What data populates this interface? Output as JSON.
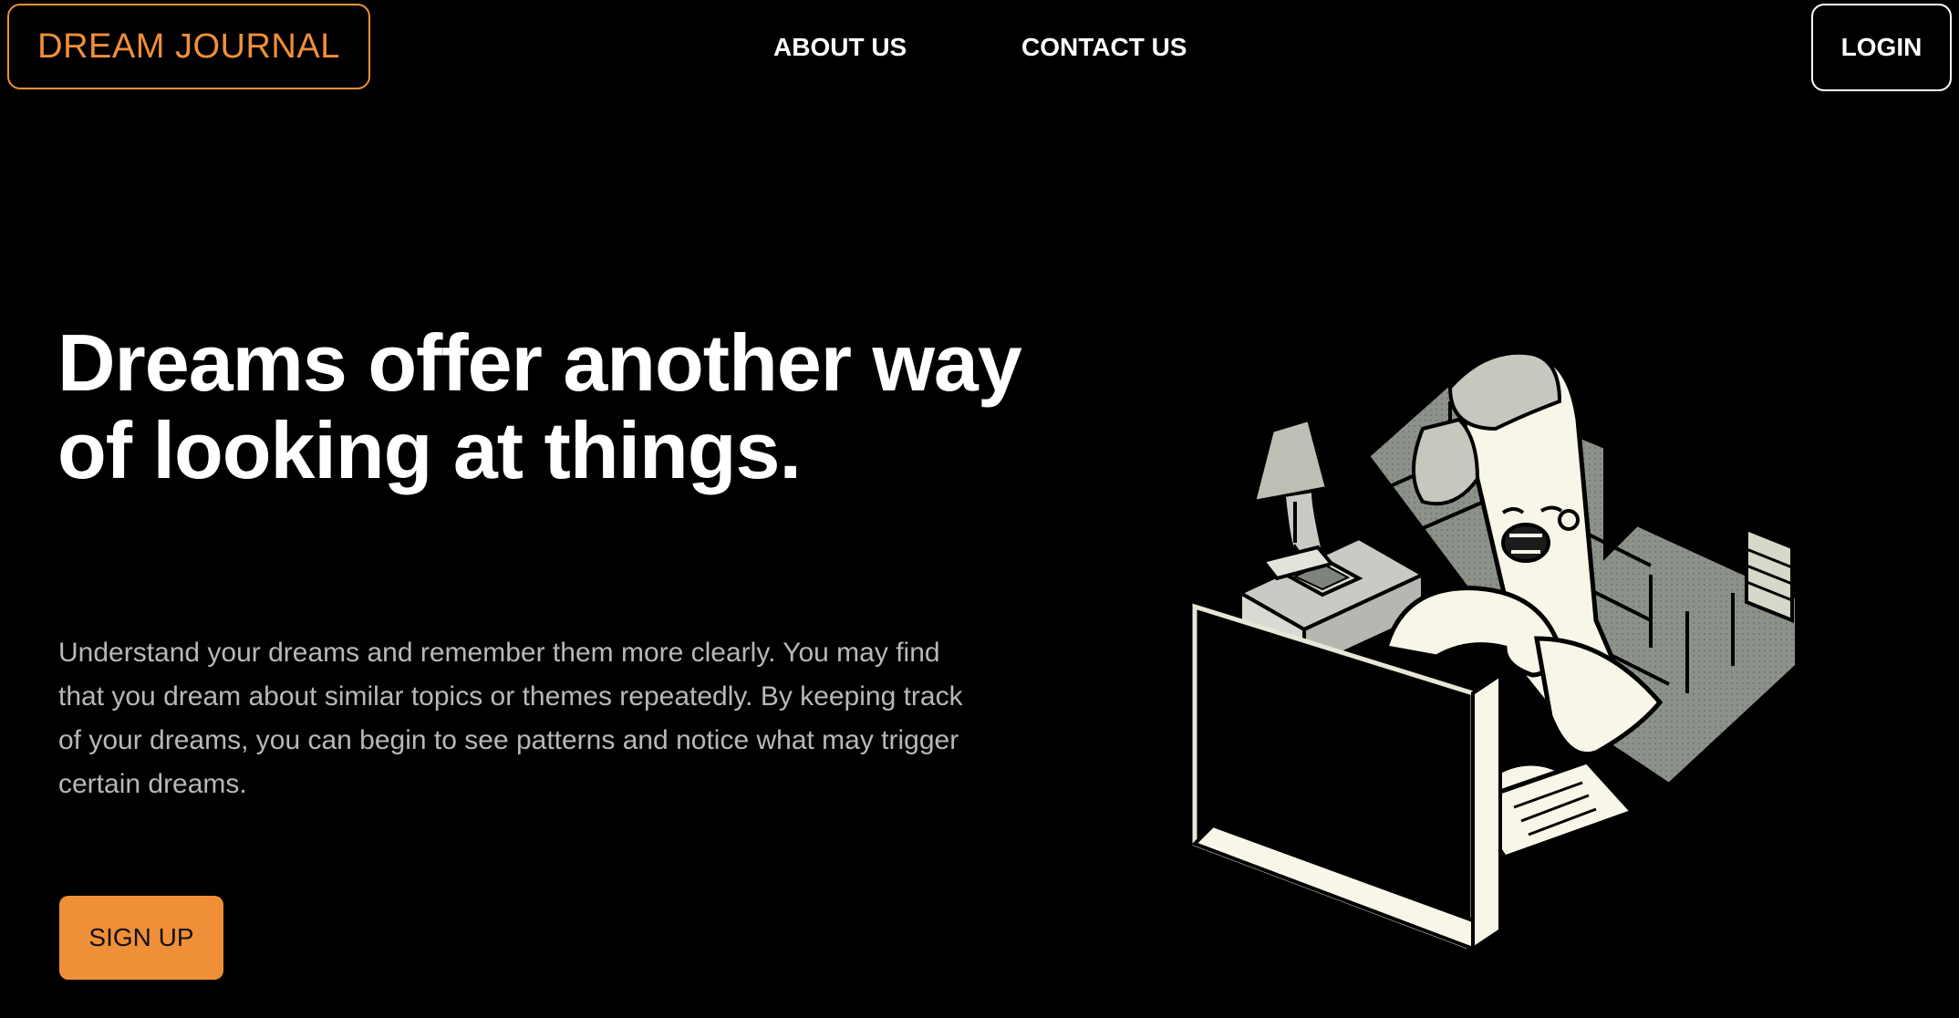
{
  "header": {
    "brand": "DREAM JOURNAL",
    "nav": {
      "about": "ABOUT US",
      "contact": "CONTACT US"
    },
    "login_label": "LOGIN"
  },
  "hero": {
    "title": "Dreams offer another way of looking at things.",
    "description": "Understand your dreams and remember them more clearly. You may find that you dream about similar topics or themes repeatedly. By keeping track of your dreams, you can begin to see patterns and notice what may trigger certain dreams.",
    "signup_label": "SIGN UP"
  },
  "illustration": {
    "icon": "sleeping-person-at-computer-illustration"
  },
  "colors": {
    "background": "#000000",
    "accent": "#ef9038",
    "text_primary": "#ffffff",
    "text_secondary": "#b8b8b8",
    "illustration_fill": "#f7f6e8",
    "illustration_gray": "#8c918a"
  }
}
